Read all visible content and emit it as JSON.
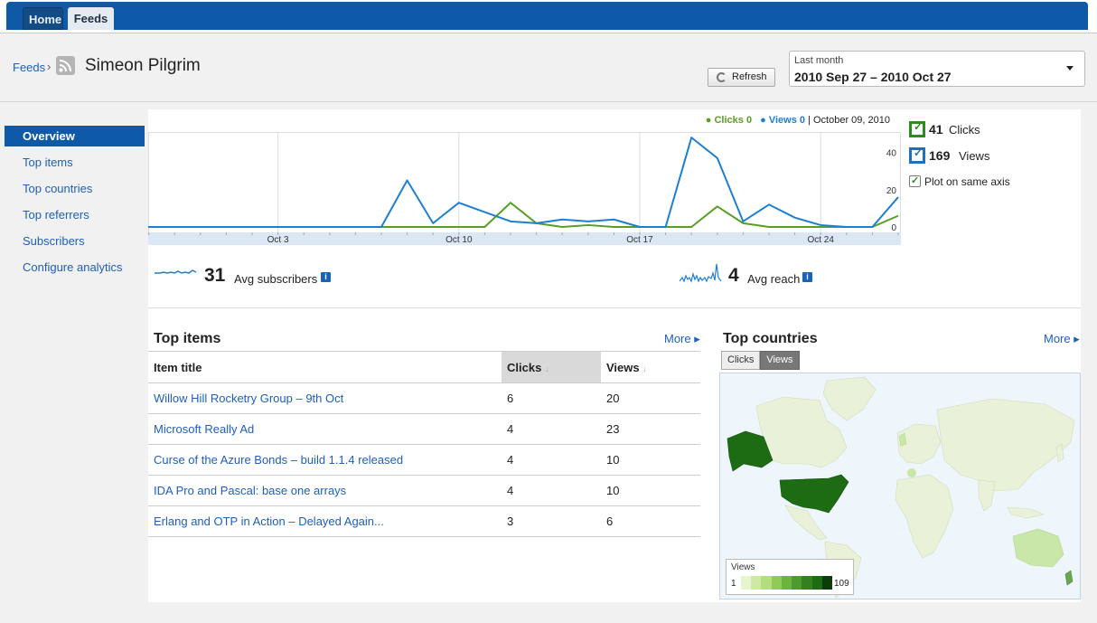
{
  "tabs": [
    {
      "label": "Home"
    },
    {
      "label": "Feeds"
    }
  ],
  "breadcrumb": {
    "feeds_label": "Feeds",
    "separator": "›",
    "title": "Simeon Pilgrim"
  },
  "toolbar": {
    "refresh_label": "Refresh"
  },
  "daterange": {
    "label": "Last month",
    "value": "2010 Sep 27 – 2010 Oct 27"
  },
  "sidebar": {
    "items": [
      {
        "label": "Overview",
        "active": true
      },
      {
        "label": "Top items"
      },
      {
        "label": "Top countries"
      },
      {
        "label": "Top referrers"
      },
      {
        "label": "Subscribers"
      },
      {
        "label": "Configure analytics"
      }
    ]
  },
  "chart_legend": {
    "clicks": "● Clicks 0",
    "views": "● Views 0",
    "date": "| October 09, 2010"
  },
  "series_panel": {
    "clicks": {
      "value": "41",
      "label": "Clicks",
      "color": "#5a9e25"
    },
    "views": {
      "value": "169",
      "label": "Views",
      "color": "#1f7fcf"
    },
    "same_axis_label": "Plot on same axis"
  },
  "chart_data": {
    "type": "line",
    "x": [
      "Sep 27",
      "Sep 28",
      "Sep 29",
      "Sep 30",
      "Oct 1",
      "Oct 2",
      "Oct 3",
      "Oct 4",
      "Oct 5",
      "Oct 6",
      "Oct 7",
      "Oct 8",
      "Oct 9",
      "Oct 10",
      "Oct 11",
      "Oct 12",
      "Oct 13",
      "Oct 14",
      "Oct 15",
      "Oct 16",
      "Oct 17",
      "Oct 18",
      "Oct 19",
      "Oct 20",
      "Oct 21",
      "Oct 22",
      "Oct 23",
      "Oct 24",
      "Oct 25",
      "Oct 26",
      "Oct 27"
    ],
    "tick_labels": [
      "Oct 3",
      "Oct 10",
      "Oct 17",
      "Oct 24"
    ],
    "yticks": [
      0,
      20,
      40
    ],
    "ylim": [
      0,
      50
    ],
    "series": [
      {
        "name": "Clicks",
        "color": "#5a9e25",
        "values": [
          0,
          0,
          0,
          0,
          0,
          0,
          0,
          0,
          0,
          0,
          0,
          0,
          0,
          0,
          0,
          13,
          2,
          0,
          1,
          0,
          0,
          0,
          0,
          11,
          2,
          0,
          0,
          0,
          0,
          0,
          6
        ]
      },
      {
        "name": "Views",
        "color": "#1f7fcf",
        "values": [
          0,
          0,
          0,
          0,
          0,
          0,
          0,
          0,
          0,
          0,
          0,
          25,
          2,
          13,
          8,
          3,
          2,
          4,
          3,
          4,
          0,
          0,
          48,
          37,
          3,
          12,
          5,
          1,
          0,
          0,
          16
        ]
      }
    ]
  },
  "stats": {
    "subscribers": {
      "value": "31",
      "label": "Avg subscribers"
    },
    "reach": {
      "value": "4",
      "label": "Avg reach"
    },
    "info_glyph": "i"
  },
  "top_items": {
    "title": "Top items",
    "more": "More ▸",
    "columns": [
      "Item title",
      "Clicks",
      "Views"
    ],
    "rows": [
      {
        "title": "Willow Hill Rocketry Group – 9th Oct",
        "clicks": "6",
        "views": "20"
      },
      {
        "title": "Microsoft Really Ad",
        "clicks": "4",
        "views": "23"
      },
      {
        "title": "Curse of the Azure Bonds – build 1.1.4 released",
        "clicks": "4",
        "views": "10"
      },
      {
        "title": "IDA Pro and Pascal: base one arrays",
        "clicks": "4",
        "views": "10"
      },
      {
        "title": "Erlang and OTP in Action – Delayed Again...",
        "clicks": "3",
        "views": "6"
      }
    ]
  },
  "top_countries": {
    "title": "Top countries",
    "more": "More ▸",
    "toggle": [
      "Clicks",
      "Views"
    ],
    "active_toggle": "Views",
    "scale": {
      "title": "Views",
      "min": "1",
      "max": "109"
    },
    "colors": {
      "land": "#e9f2d8",
      "low": "#c9e7a8",
      "high": "#1d6b12",
      "water": "#eef5fb"
    }
  }
}
